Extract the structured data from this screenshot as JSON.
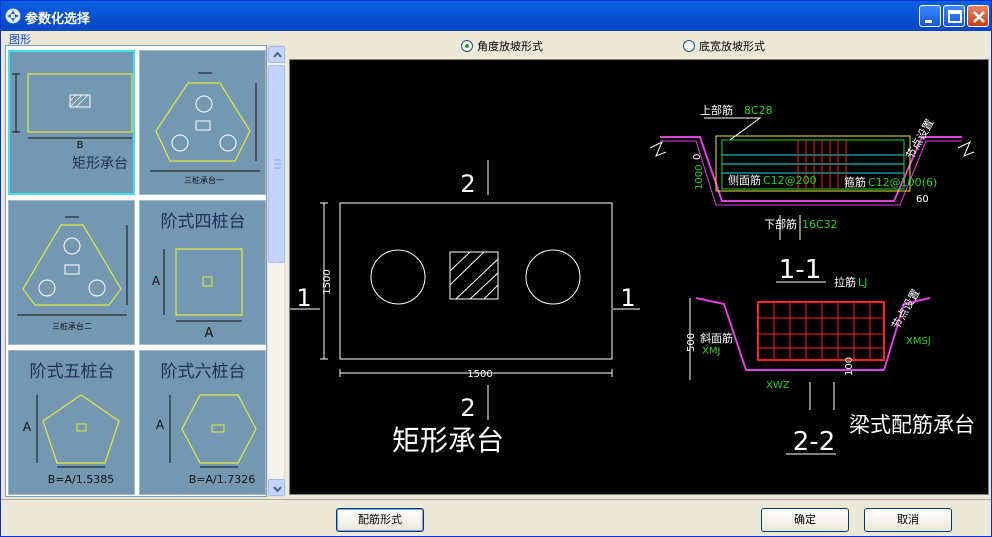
{
  "window": {
    "title": "参数化选择"
  },
  "group_label": "图形",
  "radios": [
    {
      "label": "角度放坡形式",
      "checked": true
    },
    {
      "label": "底宽放坡形式",
      "checked": false
    }
  ],
  "thumbnails": {
    "t1": {
      "dim_b": "B",
      "caption": "矩形承台",
      "selected": true
    },
    "t2": {
      "caption": "三桩承台一"
    },
    "t3": {
      "caption": "三桩承台二"
    },
    "t4": {
      "title": "阶式四桩台",
      "dim_a1": "A",
      "dim_a2": "A"
    },
    "t5": {
      "title": "阶式五桩台",
      "dim_a": "A",
      "formula": "B=A/1.5385"
    },
    "t6": {
      "title": "阶式六桩台",
      "dim_a": "A",
      "formula": "B=A/1.7326"
    }
  },
  "preview": {
    "left": {
      "sec_top": "2",
      "sec_bottom": "2",
      "sec_left": "1",
      "sec_right": "1",
      "dim_width": "1500",
      "dim_height": "1500",
      "caption": "矩形承台"
    },
    "section11": {
      "top_label": "上部筋",
      "top_value": "8C28",
      "side_label": "侧面筋",
      "side_value": "C12@200",
      "stirrup_label": "箍筋",
      "stirrup_value": "C12@100(6)",
      "bottom_label": "下部筋",
      "bottom_value": "16C32",
      "angle": "60",
      "zero": "0",
      "height": "1000",
      "node_label": "节点设置",
      "name": "1-1"
    },
    "section22": {
      "tie_label": "拉筋",
      "tie_value": "LJ",
      "slope_label": "斜面筋",
      "xmj": "XMJ",
      "xmsj": "XMSJ",
      "xwz": "XWZ",
      "height": "500",
      "dim100": "100",
      "node_label": "节点设置",
      "name": "2-2",
      "caption": "梁式配筋承台"
    }
  },
  "buttons": {
    "rebar_form": "配筋形式",
    "ok": "确定",
    "cancel": "取消"
  }
}
